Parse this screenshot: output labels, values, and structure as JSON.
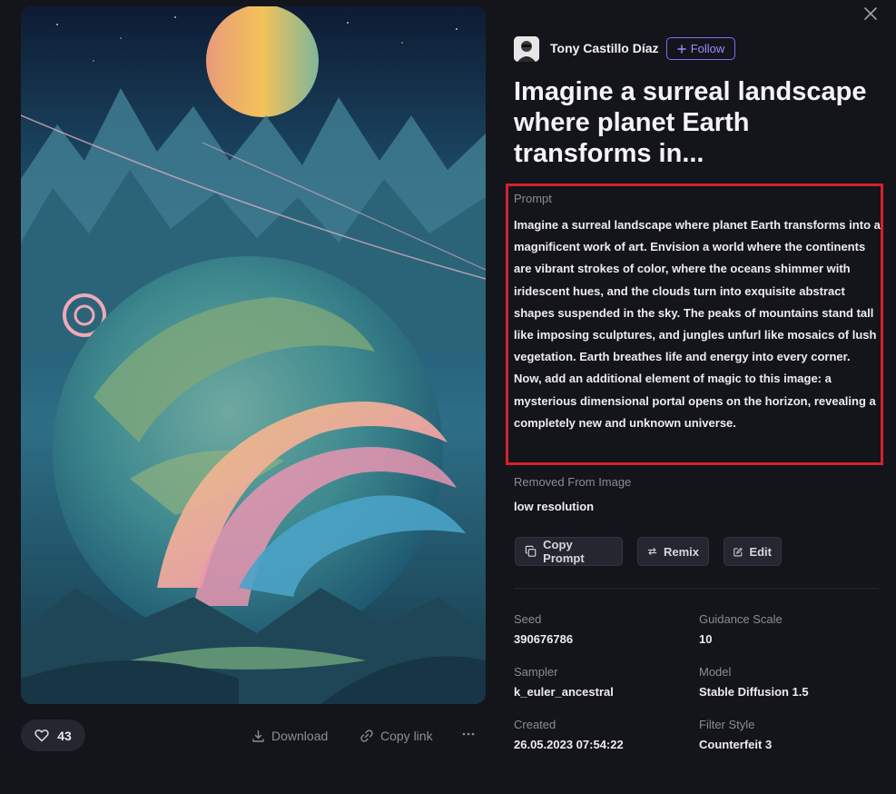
{
  "author": {
    "name": "Tony Castillo Díaz",
    "follow_label": "Follow"
  },
  "title": "Imagine a surreal landscape where planet Earth transforms in...",
  "prompt": {
    "label": "Prompt",
    "text": "Imagine a surreal landscape where planet Earth transforms into a magnificent work of art. Envision a world where the continents are vibrant strokes of color, where the oceans shimmer with iridescent hues, and the clouds turn into exquisite abstract shapes suspended in the sky. The peaks of mountains stand tall like imposing sculptures, and jungles unfurl like mosaics of lush vegetation. Earth breathes life and energy into every corner. Now, add an additional element of magic to this image: a mysterious dimensional portal opens on the horizon, revealing a completely new and unknown universe."
  },
  "removed": {
    "label": "Removed From Image",
    "value": "low resolution"
  },
  "actions": {
    "copy_prompt": "Copy Prompt",
    "remix": "Remix",
    "edit": "Edit"
  },
  "meta": {
    "seed": {
      "label": "Seed",
      "value": "390676786"
    },
    "guidance": {
      "label": "Guidance Scale",
      "value": "10"
    },
    "sampler": {
      "label": "Sampler",
      "value": "k_euler_ancestral"
    },
    "model": {
      "label": "Model",
      "value": "Stable Diffusion 1.5"
    },
    "created": {
      "label": "Created",
      "value": "26.05.2023 07:54:22"
    },
    "filter": {
      "label": "Filter Style",
      "value": "Counterfeit 3"
    }
  },
  "footer": {
    "likes": "43",
    "download": "Download",
    "copy_link": "Copy link"
  },
  "icons": {
    "close": "close-icon",
    "heart": "heart-icon",
    "download": "download-icon",
    "link": "link-icon",
    "more": "more-icon",
    "plus": "plus-icon",
    "copy": "copy-icon",
    "remix": "remix-icon",
    "edit": "edit-icon"
  },
  "colors": {
    "accent": "#7c6cf2",
    "highlight_border": "#d3222a",
    "background": "#14141b"
  }
}
